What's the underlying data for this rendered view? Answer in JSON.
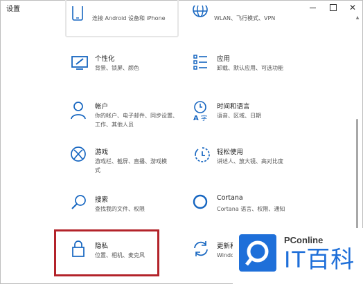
{
  "window": {
    "title": "设置",
    "controls": [
      "minimize",
      "maximize",
      "close"
    ]
  },
  "top_partial": {
    "left_desc": "连接 Android 设备和 iPhone",
    "right_desc": "WLAN、飞行模式、VPN"
  },
  "items": [
    {
      "key": "personalization",
      "name": "个性化",
      "desc": "背景、锁屏、颜色",
      "icon": "personalization-icon"
    },
    {
      "key": "apps",
      "name": "应用",
      "desc": "卸载、默认应用、可选功能",
      "icon": "apps-icon"
    },
    {
      "key": "accounts",
      "name": "帐户",
      "desc": "你的帐户、电子邮件、同步设置、工作、其他人员",
      "desc_line1": "你的帐户、电子邮件、同步设置、",
      "desc_line2": "工作、其他人员",
      "icon": "account-icon"
    },
    {
      "key": "time-language",
      "name": "时间和语言",
      "desc": "语音、区域、日期",
      "icon": "time-language-icon"
    },
    {
      "key": "gaming",
      "name": "游戏",
      "desc_line1": "游戏栏、截屏、直播、游戏模",
      "desc_line2": "式",
      "icon": "xbox-icon"
    },
    {
      "key": "ease-of-access",
      "name": "轻松使用",
      "desc_line1": "讲述人、放大镜、高对比度",
      "icon": "ease-of-access-icon"
    },
    {
      "key": "search",
      "name": "搜索",
      "desc_line1": "查找我的文件、权限",
      "icon": "search-icon"
    },
    {
      "key": "cortana",
      "name": "Cortana",
      "desc_line1": "Cortana 语言、权限、通知",
      "icon": "cortana-icon"
    },
    {
      "key": "privacy",
      "name": "隐私",
      "desc_line1": "位置、相机、麦克风",
      "icon": "lock-icon"
    },
    {
      "key": "update-security",
      "name": "更新和",
      "desc_line1": "Windo",
      "icon": "update-icon"
    }
  ],
  "watermark": {
    "brand": "PConline",
    "big_text": "IT百科"
  },
  "colors": {
    "accent": "#1e6fd9",
    "icon_blue": "#1565c0",
    "highlight_border": "#b3232a"
  }
}
